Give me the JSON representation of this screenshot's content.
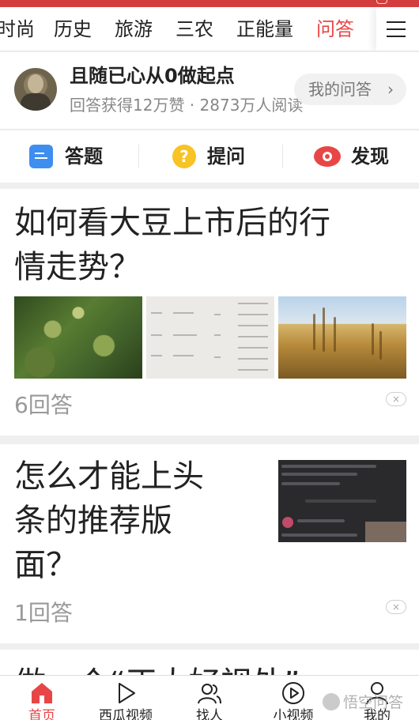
{
  "channels": [
    {
      "label": "时尚"
    },
    {
      "label": "历史"
    },
    {
      "label": "旅游"
    },
    {
      "label": "三农"
    },
    {
      "label": "正能量"
    },
    {
      "label": "问答",
      "active": true
    }
  ],
  "colors": {
    "accent": "#e84646",
    "answer_icon": "#3e8ef0",
    "ask_icon": "#f7c325"
  },
  "profile": {
    "name": "且随已心从0做起点",
    "stats": "回答获得12万赞 · 2873万人阅读",
    "my_answers": "我的问答",
    "my_answers_chevron": "›"
  },
  "actions": [
    {
      "label": "答题",
      "icon": "answer-doc-icon"
    },
    {
      "label": "提问",
      "icon": "question-icon",
      "glyph": "?"
    },
    {
      "label": "发现",
      "icon": "eye-icon"
    }
  ],
  "questions": [
    {
      "title_lines": [
        "如何看大豆上市后的行",
        "情走势？"
      ],
      "answers": "6回答",
      "thumbnails": [
        "soybean-plant-image",
        "price-list-image",
        "soybean-field-image"
      ],
      "dismiss": "×"
    },
    {
      "title_lines": [
        "怎么才能上头",
        "条的推荐版",
        "面？"
      ],
      "answers": "1回答",
      "thumbnails": [
        "app-screenshot-image"
      ],
      "dismiss": "×"
    }
  ],
  "peek_title": "做一个“正大好视处”",
  "tabs": [
    {
      "label": "首页",
      "icon": "home-icon",
      "active": true
    },
    {
      "label": "西瓜视频",
      "icon": "play-icon"
    },
    {
      "label": "找人",
      "icon": "people-icon"
    },
    {
      "label": "小视频",
      "icon": "small-video-icon"
    },
    {
      "label": "我的",
      "icon": "profile-icon"
    }
  ],
  "watermark": "悟空问答"
}
